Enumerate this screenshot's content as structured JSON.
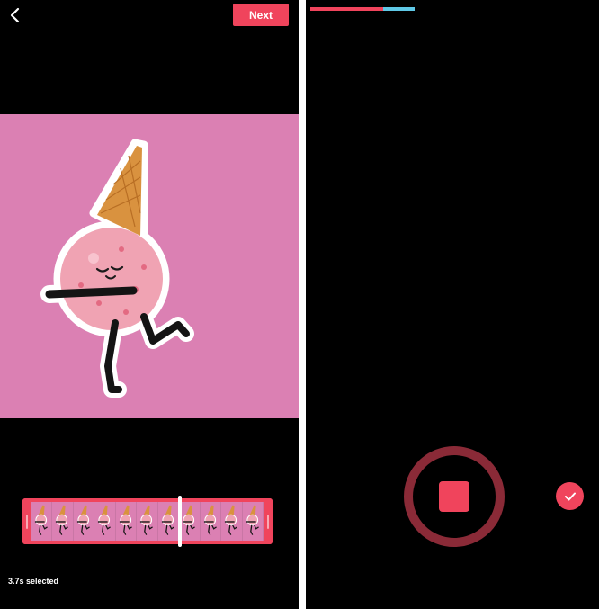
{
  "editor": {
    "next_label": "Next",
    "selected_text": "3.7s selected",
    "frame_count": 11,
    "playhead_position": 0.64
  },
  "recorder": {
    "progress_recorded": 0.7,
    "progress_current": 0.3
  },
  "icons": {
    "back": "chevron-left-icon",
    "stop": "stop-icon",
    "confirm": "checkmark-icon"
  },
  "colors": {
    "accent": "#f0445c",
    "ring": "#8a2a37",
    "preview_bg": "#db80b3",
    "progress_current": "#5fc8e6"
  }
}
